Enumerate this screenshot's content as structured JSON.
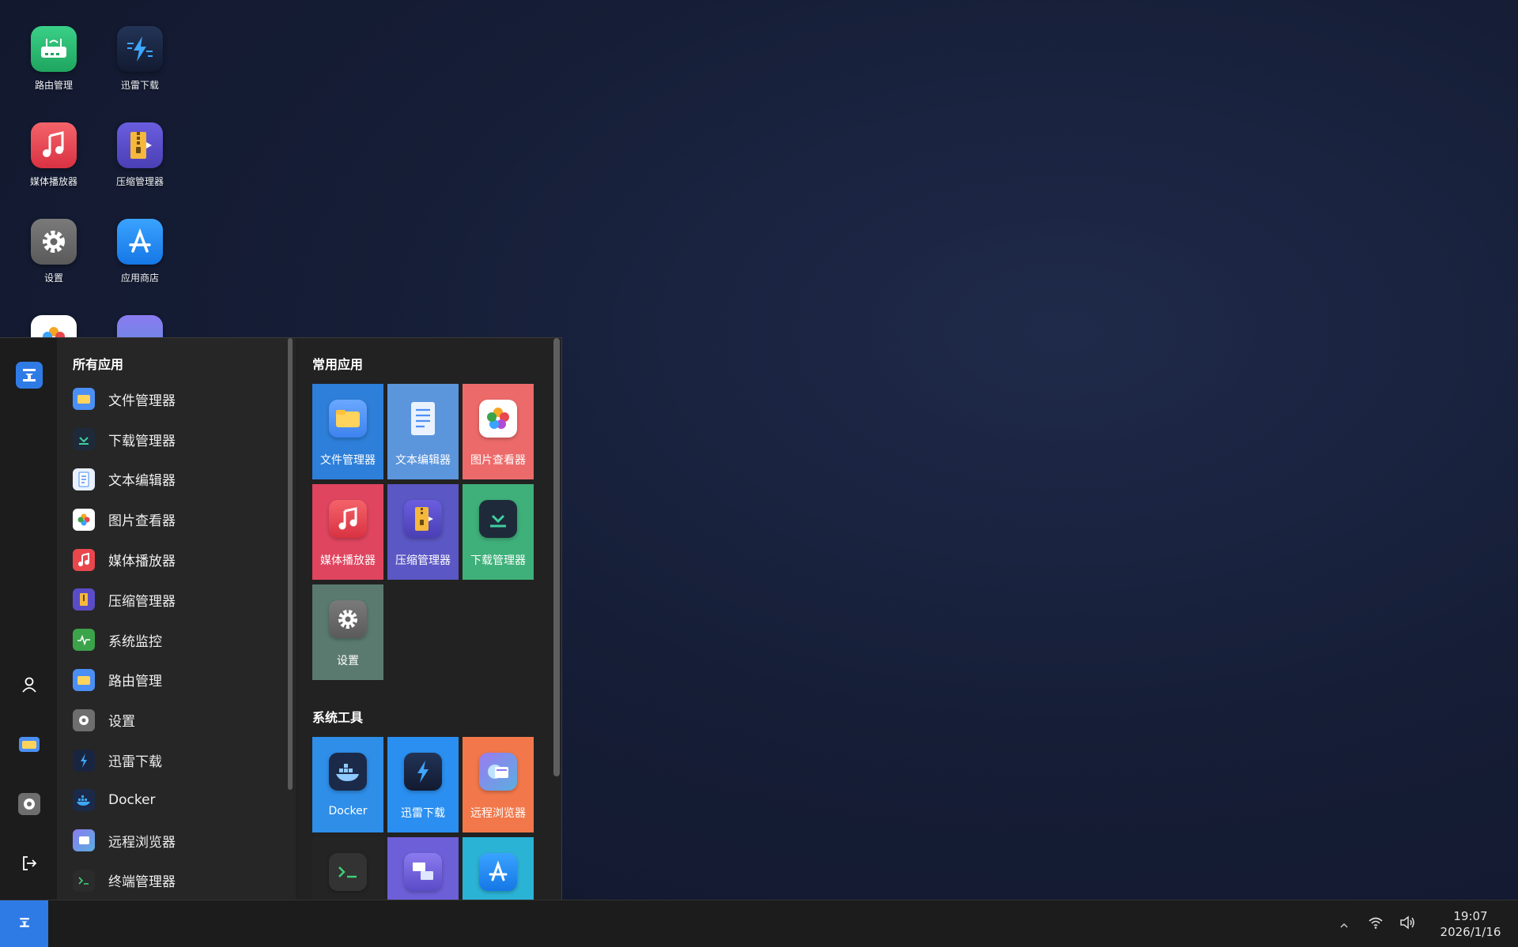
{
  "desktop": {
    "icons": [
      {
        "label": "路由管理",
        "icon": "router-icon",
        "color": "#2dbd6e"
      },
      {
        "label": "迅雷下载",
        "icon": "thunder-icon",
        "color": "#19243f"
      },
      {
        "label": "媒体播放器",
        "icon": "music-icon",
        "color": "#e8474d"
      },
      {
        "label": "压缩管理器",
        "icon": "zip-icon",
        "color": "#5a4cc7"
      },
      {
        "label": "设置",
        "icon": "gear-icon",
        "color": "#6e6e6e"
      },
      {
        "label": "应用商店",
        "icon": "app-store-icon",
        "color": "#1f8cf5"
      }
    ]
  },
  "start_menu": {
    "all_apps_title": "所有应用",
    "apps": [
      {
        "label": "文件管理器",
        "icon": "folder-icon",
        "color": "#4b8ff5"
      },
      {
        "label": "下载管理器",
        "icon": "download-icon",
        "color": "#1e2a3a"
      },
      {
        "label": "文本编辑器",
        "icon": "document-icon",
        "color": "#e9f1ff"
      },
      {
        "label": "图片查看器",
        "icon": "photos-icon",
        "color": "#ffffff"
      },
      {
        "label": "媒体播放器",
        "icon": "music-icon",
        "color": "#e8474d"
      },
      {
        "label": "压缩管理器",
        "icon": "zip-icon",
        "color": "#5a4cc7"
      },
      {
        "label": "系统监控",
        "icon": "monitor-icon",
        "color": "#3ba34a"
      },
      {
        "label": "路由管理",
        "icon": "folder-icon",
        "color": "#4b8ff5"
      },
      {
        "label": "设置",
        "icon": "gear-icon",
        "color": "#6e6e6e"
      },
      {
        "label": "迅雷下载",
        "icon": "thunder-icon",
        "color": "#19243f"
      },
      {
        "label": "Docker",
        "icon": "docker-icon",
        "color": "#1a2a48"
      },
      {
        "label": "远程浏览器",
        "icon": "remote-browser-icon",
        "color": "#7c6ae0"
      },
      {
        "label": "终端管理器",
        "icon": "terminal-icon",
        "color": "#2b2b2b"
      }
    ],
    "common_title": "常用应用",
    "common_tiles": [
      {
        "label": "文件管理器",
        "icon": "folder-icon",
        "bg": "#2d7fd9"
      },
      {
        "label": "文本编辑器",
        "icon": "document-icon",
        "bg": "#5b95dc"
      },
      {
        "label": "图片查看器",
        "icon": "photos-icon",
        "bg": "#ed6a6a"
      },
      {
        "label": "媒体播放器",
        "icon": "music-icon",
        "bg": "#e0455f"
      },
      {
        "label": "压缩管理器",
        "icon": "zip-icon",
        "bg": "#5b57c4"
      },
      {
        "label": "下载管理器",
        "icon": "download-icon",
        "bg": "#3fb07a"
      },
      {
        "label": "设置",
        "icon": "gear-icon",
        "bg": "#5a7a70"
      }
    ],
    "tools_title": "系统工具",
    "tool_tiles": [
      {
        "label": "Docker",
        "icon": "docker-icon",
        "bg": "#2e8ee8"
      },
      {
        "label": "迅雷下载",
        "icon": "thunder-icon",
        "bg": "#2a8ff0"
      },
      {
        "label": "远程浏览器",
        "icon": "remote-browser-icon",
        "bg": "#f2784b"
      },
      {
        "label": "",
        "icon": "terminal-icon",
        "bg": "#242424"
      },
      {
        "label": "",
        "icon": "remote-desktop-icon",
        "bg": "#6d5fd8"
      },
      {
        "label": "",
        "icon": "app-store-icon",
        "bg": "#2bb3d6"
      }
    ]
  },
  "taskbar": {
    "time": "19:07",
    "date": "2026/1/16"
  },
  "colors": {
    "accent": "#2f7be6",
    "menu_bg": "#262626",
    "taskbar_bg": "#1c1c1c"
  }
}
